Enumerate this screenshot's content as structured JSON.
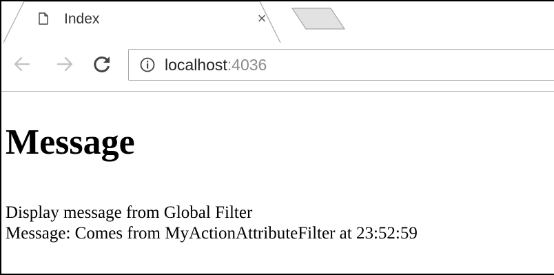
{
  "browser": {
    "tab": {
      "title": "Index",
      "icon": "document-icon",
      "close_glyph": "×"
    },
    "new_tab_icon": "new-tab-icon",
    "toolbar": {
      "back_icon": "arrow-left-icon",
      "forward_icon": "arrow-right-icon",
      "reload_icon": "reload-icon"
    },
    "address_bar": {
      "security_icon": "info-icon",
      "host": "localhost",
      "port": ":4036"
    }
  },
  "page": {
    "heading": "Message",
    "lines": [
      "Display message from Global Filter",
      "Message: Comes from MyActionAttributeFilter at 23:52:59"
    ]
  },
  "colors": {
    "tab_border": "#a8a8a8",
    "inactive_tab_fill": "#e2e2e2",
    "nav_icon_disabled": "#c4c4c4",
    "nav_icon_enabled": "#444444",
    "url_port": "#8a8a8a"
  }
}
